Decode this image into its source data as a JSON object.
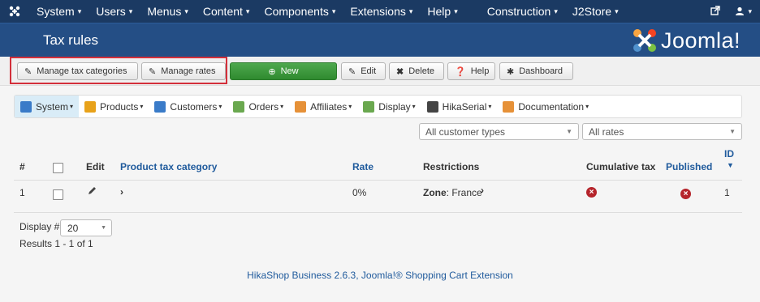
{
  "topnav": {
    "menus": [
      {
        "label": "System",
        "caret": true
      },
      {
        "label": "Users",
        "caret": true
      },
      {
        "label": "Menus",
        "caret": true
      },
      {
        "label": "Content",
        "caret": true
      },
      {
        "label": "Components",
        "caret": true
      },
      {
        "label": "Extensions",
        "caret": true
      },
      {
        "label": "Help",
        "caret": true
      },
      {
        "label": "Construction",
        "caret": true
      },
      {
        "label": "J2Store",
        "caret": true
      }
    ]
  },
  "header": {
    "title": "Tax rules",
    "brand": "Joomla!"
  },
  "toolbar": {
    "manage_tax_categories": "Manage tax categories",
    "manage_rates": "Manage rates",
    "new": "New",
    "edit": "Edit",
    "delete": "Delete",
    "help": "Help",
    "dashboard": "Dashboard"
  },
  "submenu": [
    {
      "label": "System",
      "icon": "wrench-icon",
      "color": "#3a7bc8",
      "active": true
    },
    {
      "label": "Products",
      "icon": "box-icon",
      "color": "#e8a21a"
    },
    {
      "label": "Customers",
      "icon": "users-icon",
      "color": "#3a7bc8"
    },
    {
      "label": "Orders",
      "icon": "orders-icon",
      "color": "#6aa84f"
    },
    {
      "label": "Affiliates",
      "icon": "affiliates-icon",
      "color": "#e69138"
    },
    {
      "label": "Display",
      "icon": "display-icon",
      "color": "#6aa84f"
    },
    {
      "label": "HikaSerial",
      "icon": "hikaserial-icon",
      "color": "#444444"
    },
    {
      "label": "Documentation",
      "icon": "documentation-icon",
      "color": "#e69138"
    }
  ],
  "filters": {
    "customer_types": "All customer types",
    "rates": "All rates"
  },
  "table": {
    "headers": {
      "num": "#",
      "edit": "Edit",
      "product_tax_category": "Product tax category",
      "rate": "Rate",
      "restrictions": "Restrictions",
      "cumulative_tax": "Cumulative tax",
      "published": "Published",
      "id": "ID"
    },
    "rows": [
      {
        "num": "1",
        "rate": "0%",
        "restriction_label": "Zone",
        "restriction_value": ": France",
        "id": "1"
      }
    ]
  },
  "pagination": {
    "display_label": "Display #",
    "display_value": "20",
    "results": "Results 1 - 1 of 1"
  },
  "footer": "HikaShop Business 2.6.3, Joomla!® Shopping Cart Extension"
}
